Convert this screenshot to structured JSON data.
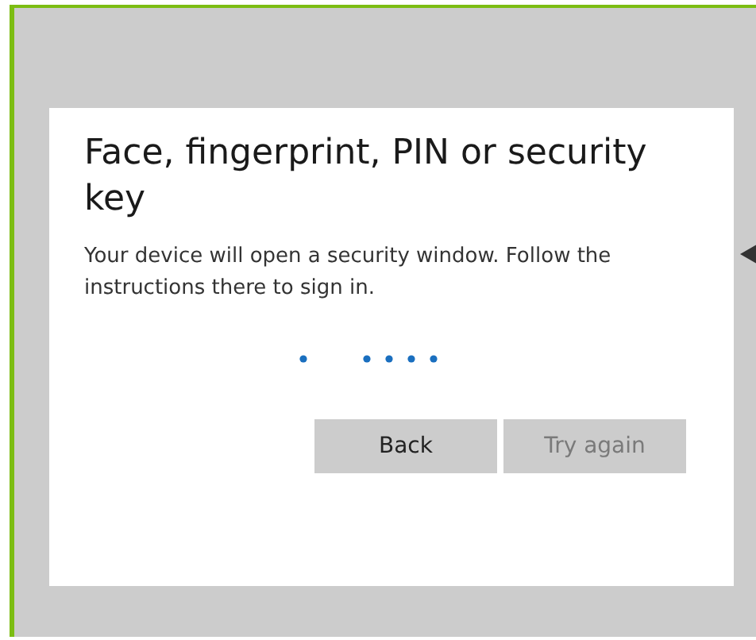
{
  "dialog": {
    "title": "Face, fingerprint, PIN or security key",
    "message": "Your device will open a security window. Follow the instructions there to sign in.",
    "buttons": [
      {
        "label": "Back",
        "disabled": false
      },
      {
        "label": "Try again",
        "disabled": true
      }
    ]
  }
}
